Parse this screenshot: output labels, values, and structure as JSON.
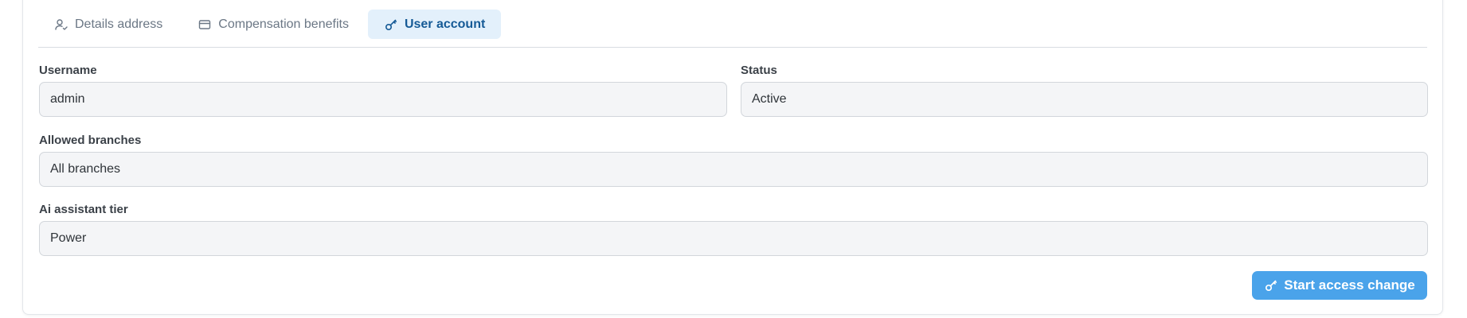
{
  "tabs": [
    {
      "label": "Details address",
      "icon": "user-check-icon",
      "active": false
    },
    {
      "label": "Compensation benefits",
      "icon": "credit-card-icon",
      "active": false
    },
    {
      "label": "User account",
      "icon": "key-icon",
      "active": true
    }
  ],
  "form": {
    "username": {
      "label": "Username",
      "value": "admin"
    },
    "status": {
      "label": "Status",
      "value": "Active"
    },
    "allowed_branches": {
      "label": "Allowed branches",
      "value": "All branches"
    },
    "ai_assistant_tier": {
      "label": "Ai assistant tier",
      "value": "Power"
    }
  },
  "actions": {
    "start_access_change": {
      "label": "Start access change",
      "icon": "key-icon"
    }
  },
  "colors": {
    "accent": "#4aa3ea",
    "active_tab_bg": "#e3f0fb",
    "active_tab_text": "#155a96",
    "field_bg": "#f4f5f7"
  }
}
